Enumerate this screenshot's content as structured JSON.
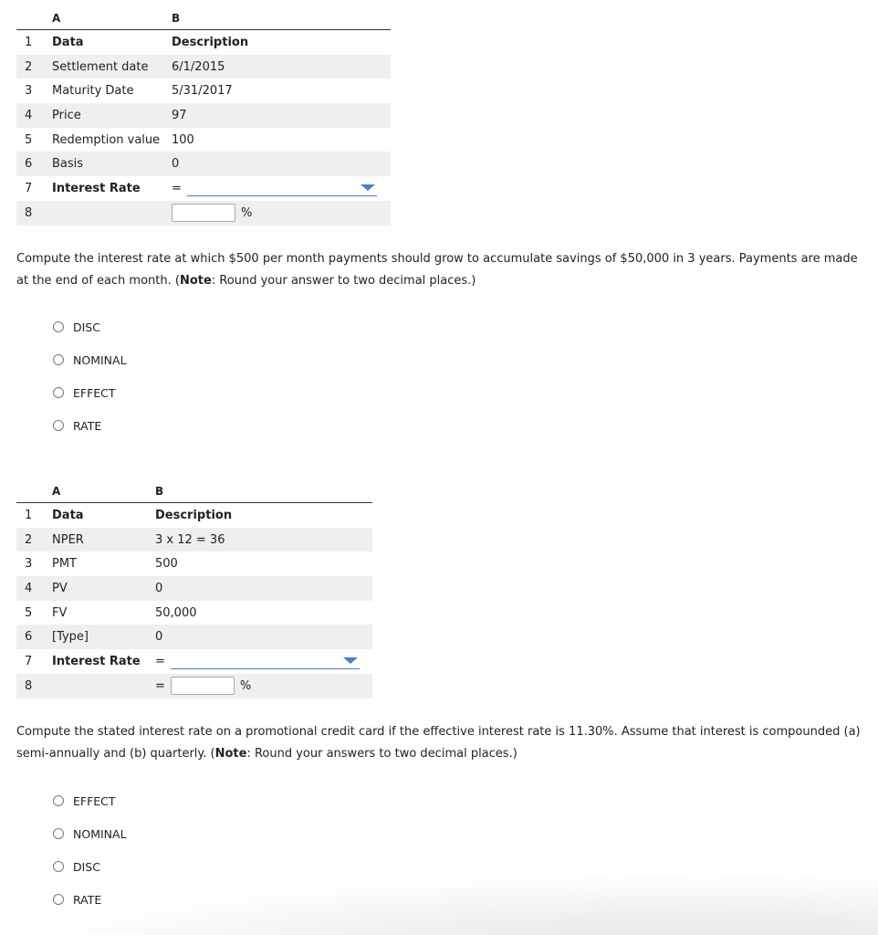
{
  "table1": {
    "col_a": "A",
    "col_b": "B",
    "rows": [
      {
        "num": "1",
        "a": "Data",
        "b": "Description"
      },
      {
        "num": "2",
        "a": "Settlement date",
        "b": "6/1/2015"
      },
      {
        "num": "3",
        "a": "Maturity Date",
        "b": "5/31/2017"
      },
      {
        "num": "4",
        "a": "Price",
        "b": "97"
      },
      {
        "num": "5",
        "a": "Redemption value",
        "b": "100"
      },
      {
        "num": "6",
        "a": "Basis",
        "b": "0"
      },
      {
        "num": "7",
        "a": "Interest Rate",
        "b": "="
      },
      {
        "num": "8",
        "a": "",
        "b": ""
      }
    ],
    "dropdown_value": "",
    "input_value": "",
    "unit": "%"
  },
  "question1": {
    "text_before": "Compute the interest rate at which $500 per month payments should grow to accumulate savings of $50,000 in 3 years. Payments are made at the end of each month. (",
    "note_label": "Note",
    "text_after": ": Round your answer to two decimal places.)"
  },
  "options1": [
    "DISC",
    "NOMINAL",
    "EFFECT",
    "RATE"
  ],
  "table2": {
    "col_a": "A",
    "col_b": "B",
    "rows": [
      {
        "num": "1",
        "a": "Data",
        "b": "Description"
      },
      {
        "num": "2",
        "a": "NPER",
        "b": "3 x 12 = 36"
      },
      {
        "num": "3",
        "a": "PMT",
        "b": "500"
      },
      {
        "num": "4",
        "a": "PV",
        "b": "0"
      },
      {
        "num": "5",
        "a": "FV",
        "b": "50,000"
      },
      {
        "num": "6",
        "a": "[Type]",
        "b": "0"
      },
      {
        "num": "7",
        "a": "Interest Rate",
        "b": "="
      },
      {
        "num": "8",
        "a": "",
        "b": "="
      }
    ],
    "dropdown_value": "",
    "input_value": "",
    "unit": "%"
  },
  "question2": {
    "text_before": "Compute the stated interest rate on a promotional credit card if the effective interest rate is 11.30%. Assume that interest is compounded (a) semi-annually and (b) quarterly. (",
    "note_label": "Note",
    "text_after": ": Round your answers to two decimal places.)"
  },
  "options2": [
    "EFFECT",
    "NOMINAL",
    "DISC",
    "RATE"
  ],
  "colors": {
    "accent": "#4a7fc0",
    "row_shade": "#efefef"
  }
}
